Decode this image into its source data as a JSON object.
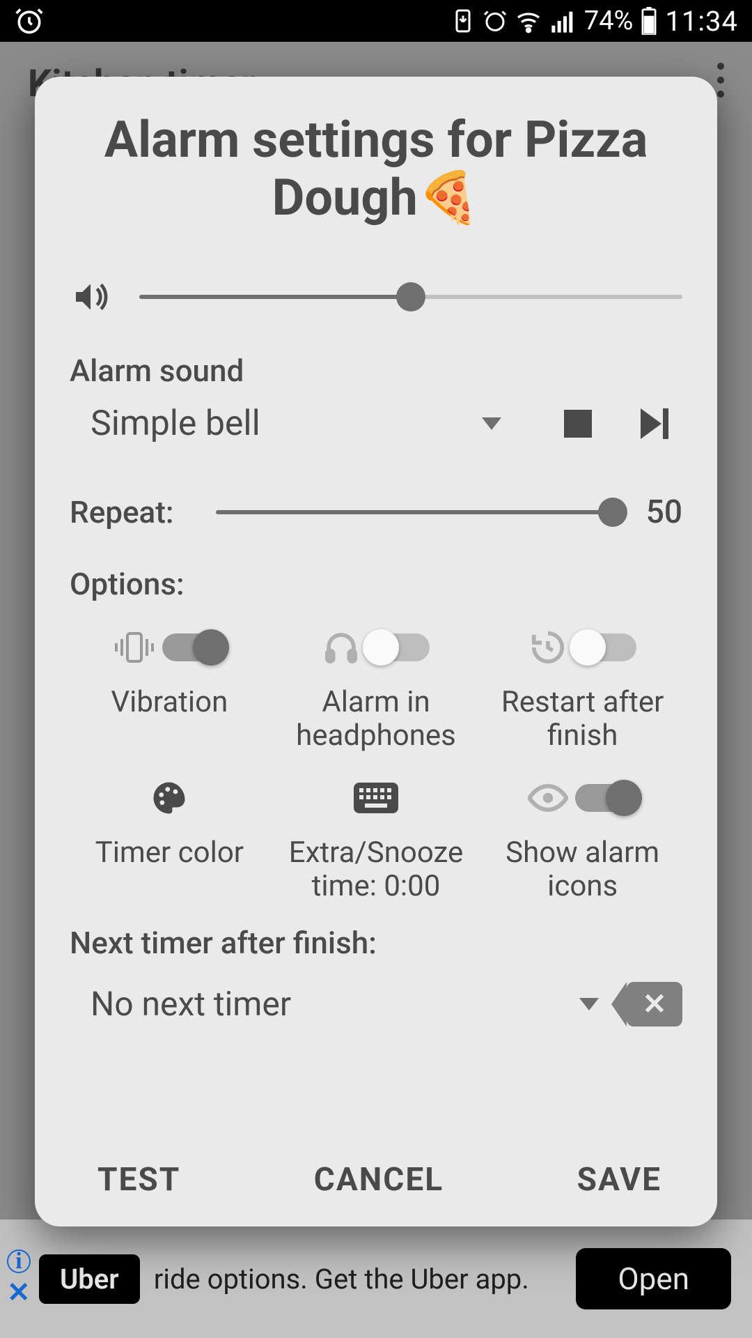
{
  "statusbar": {
    "battery_pct": "74%",
    "time": "11:34"
  },
  "background_app": {
    "title": "Kitchen timer",
    "ad": {
      "brand": "Uber",
      "text": "ride options. Get the Uber app.",
      "cta": "Open"
    }
  },
  "dialog": {
    "title": "Alarm settings for Pizza Dough🍕",
    "volume": {
      "percent": 50
    },
    "alarm_sound": {
      "label": "Alarm sound",
      "selected": "Simple bell"
    },
    "repeat": {
      "label": "Repeat:",
      "value": 50,
      "percent": 100
    },
    "options_label": "Options:",
    "options": {
      "vibration": {
        "label": "Vibration",
        "on": true
      },
      "headphones": {
        "label": "Alarm in headphones",
        "on": false
      },
      "restart": {
        "label": "Restart after finish",
        "on": false
      },
      "timer_color": {
        "label": "Timer color"
      },
      "snooze": {
        "label": "Extra/Snooze time: 0:00"
      },
      "show_icons": {
        "label": "Show alarm icons",
        "on": true
      }
    },
    "next_timer": {
      "label": "Next timer after finish:",
      "selected": "No next timer"
    },
    "buttons": {
      "test": "TEST",
      "cancel": "CANCEL",
      "save": "SAVE"
    }
  }
}
